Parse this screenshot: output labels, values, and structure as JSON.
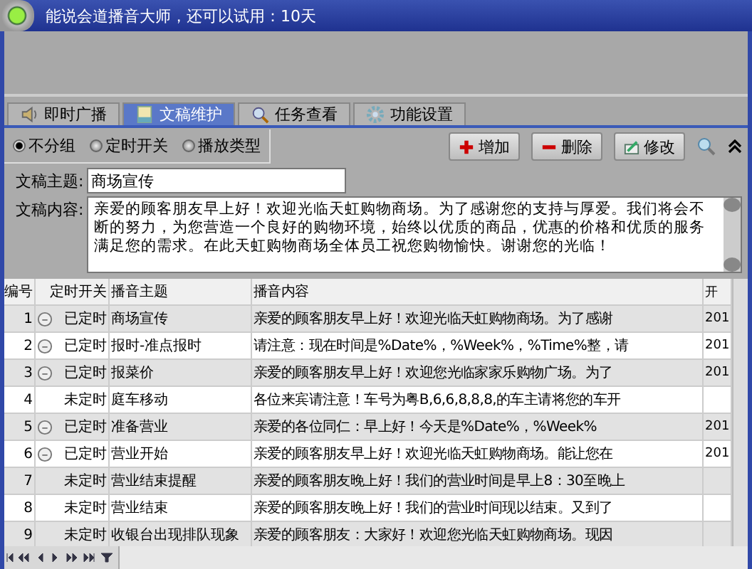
{
  "window": {
    "title": "能说会道播音大师，还可以试用：10天"
  },
  "tabs": [
    {
      "label": "即时广播",
      "selected": false
    },
    {
      "label": "文稿维护",
      "selected": true
    },
    {
      "label": "任务查看",
      "selected": false
    },
    {
      "label": "功能设置",
      "selected": false
    }
  ],
  "grouping": [
    {
      "label": "不分组",
      "selected": true
    },
    {
      "label": "定时开关",
      "selected": false
    },
    {
      "label": "播放类型",
      "selected": false
    }
  ],
  "buttons": [
    {
      "label": "增加",
      "kind": "add"
    },
    {
      "label": "删除",
      "kind": "delete"
    },
    {
      "label": "修改",
      "kind": "edit"
    }
  ],
  "form": {
    "subject_label": "文稿主题:",
    "subject": "商场宣传",
    "content_label": "文稿内容:",
    "content": "亲爱的顾客朋友早上好！欢迎光临天虹购物商场。为了感谢您的支持与厚爱。我们将会不断的努力，为您营造一个良好的购物环境，始终以优质的商品，优惠的价格和优质的服务满足您的需求。在此天虹购物商场全体员工祝您购物愉快。谢谢您的光临！"
  },
  "table": {
    "columns": [
      "编号",
      "定时开关",
      "播音主题",
      "播音内容",
      "开"
    ],
    "rows": [
      {
        "no": "1",
        "scheduled": true,
        "status": "已定时",
        "subject": "商场宣传",
        "content": "亲爱的顾客朋友早上好！欢迎光临天虹购物商场。为了感谢",
        "start": "201"
      },
      {
        "no": "2",
        "scheduled": true,
        "status": "已定时",
        "subject": "报时-准点报时",
        "content": "请注意：现在时间是%Date%，%Week%，%Time%整，请",
        "start": "201"
      },
      {
        "no": "3",
        "scheduled": true,
        "status": "已定时",
        "subject": "报菜价",
        "content": "亲爱的顾客朋友早上好！欢迎您光临家家乐购物广场。为了",
        "start": "201"
      },
      {
        "no": "4",
        "scheduled": false,
        "status": "未定时",
        "subject": "庭车移动",
        "content": "各位来宾请注意！车号为粤B,6,6,8,8,8,的车主请将您的车开",
        "start": ""
      },
      {
        "no": "5",
        "scheduled": true,
        "status": "已定时",
        "subject": "准备营业",
        "content": "亲爱的各位同仁：早上好！今天是%Date%，%Week%",
        "start": "201"
      },
      {
        "no": "6",
        "scheduled": true,
        "status": "已定时",
        "subject": "营业开始",
        "content": "亲爱的顾客朋友早上好！欢迎光临天虹购物商场。能让您在",
        "start": "201"
      },
      {
        "no": "7",
        "scheduled": false,
        "status": "未定时",
        "subject": "营业结束提醒",
        "content": "亲爱的顾客朋友晚上好！我们的营业时间是早上8：30至晚上",
        "start": ""
      },
      {
        "no": "8",
        "scheduled": false,
        "status": "未定时",
        "subject": "营业结束",
        "content": "亲爱的顾客朋友晚上好！我们的营业时间现以结束。又到了",
        "start": ""
      },
      {
        "no": "9",
        "scheduled": false,
        "status": "未定时",
        "subject": "收银台出现排队现象",
        "content": "亲爱的顾客朋友：大家好！欢迎您光临天虹购物商场。现因",
        "start": ""
      }
    ]
  }
}
